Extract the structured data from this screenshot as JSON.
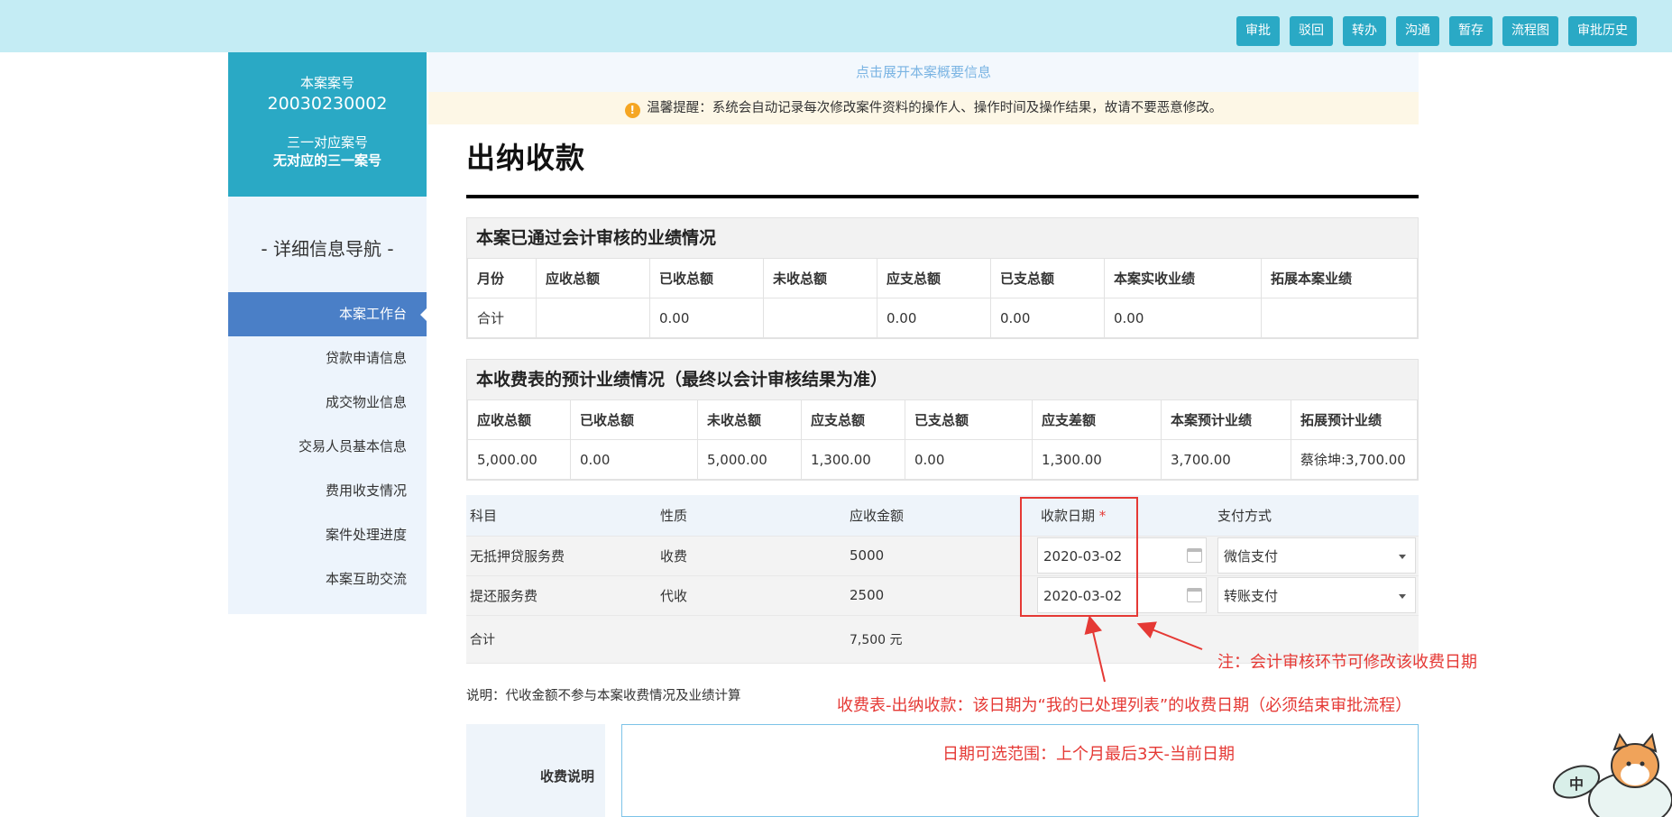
{
  "topbar": {
    "buttons": [
      "审批",
      "驳回",
      "转办",
      "沟通",
      "暂存",
      "流程图",
      "审批历史"
    ]
  },
  "sidebar": {
    "case_label": "本案案号",
    "case_number": "20030230002",
    "linked_label": "三一对应案号",
    "linked_value": "无对应的三一案号",
    "nav_title": "- 详细信息导航 -",
    "items": [
      "本案工作台",
      "贷款申请信息",
      "成交物业信息",
      "交易人员基本信息",
      "费用收支情况",
      "案件处理进度",
      "本案互助交流"
    ],
    "active_index": 0
  },
  "main": {
    "expand_link": "点击展开本案概要信息",
    "notice_icon": "!",
    "notice": "温馨提醒：系统会自动记录每次修改案件资料的操作人、操作时间及操作结果，故请不要恶意修改。",
    "title": "出纳收款"
  },
  "audited": {
    "heading": "本案已通过会计审核的业绩情况",
    "headers": [
      "月份",
      "应收总额",
      "已收总额",
      "未收总额",
      "应支总额",
      "已支总额",
      "本案实收业绩",
      "拓展本案业绩"
    ],
    "row": [
      "合计",
      "",
      "0.00",
      "",
      "0.00",
      "0.00",
      "0.00",
      ""
    ]
  },
  "estimate": {
    "heading": "本收费表的预计业绩情况（最终以会计审核结果为准）",
    "headers": [
      "应收总额",
      "已收总额",
      "未收总额",
      "应支总额",
      "已支总额",
      "应支差额",
      "本案预计业绩",
      "拓展预计业绩"
    ],
    "row": [
      "5,000.00",
      "0.00",
      "5,000.00",
      "1,300.00",
      "0.00",
      "1,300.00",
      "3,700.00",
      "蔡徐坤:3,700.00"
    ]
  },
  "fee_table": {
    "headers": {
      "subject": "科目",
      "nature": "性质",
      "amount": "应收金额",
      "date": "收款日期",
      "required": "*",
      "payment": "支付方式"
    },
    "rows": [
      {
        "subject": "无抵押贷服务费",
        "nature": "收费",
        "amount": "5000",
        "date": "2020-03-02",
        "payment": "微信支付"
      },
      {
        "subject": "提还服务费",
        "nature": "代收",
        "amount": "2500",
        "date": "2020-03-02",
        "payment": "转账支付"
      }
    ],
    "total_label": "合计",
    "total_value": "7,500 元"
  },
  "explain": "说明：代收金额不参与本案收费情况及业绩计算",
  "annotations": {
    "note_audit": "注：会计审核环节可修改该收费日期",
    "note_cashier": "收费表-出纳收款：该日期为“我的已处理列表”的收费日期（必须结束审批流程）",
    "note_range": "日期可选范围：上个月最后3天-当前日期"
  },
  "fee_desc": {
    "label": "收费说明",
    "value": ""
  },
  "mascot_badge": "中"
}
